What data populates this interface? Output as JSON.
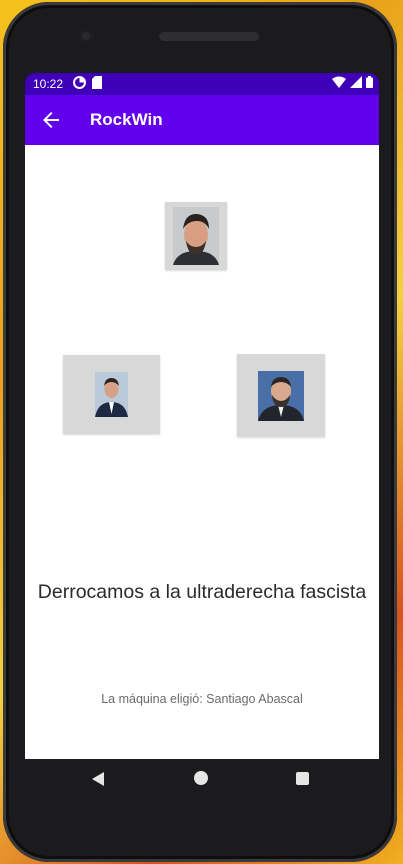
{
  "status": {
    "time": "10:22"
  },
  "app": {
    "title": "RockWin"
  },
  "options": [
    {
      "id": "top",
      "icon": "portrait-photo"
    },
    {
      "id": "left",
      "icon": "portrait-photo"
    },
    {
      "id": "right",
      "icon": "portrait-photo"
    }
  ],
  "result": {
    "message": "Derrocamos a la ultraderecha fascista",
    "machine_choice": "La máquina eligió: Santiago Abascal"
  },
  "colors": {
    "status_bar": "#3f00b8",
    "app_bar": "#6200ee",
    "option_bg": "#d8d8d8"
  }
}
